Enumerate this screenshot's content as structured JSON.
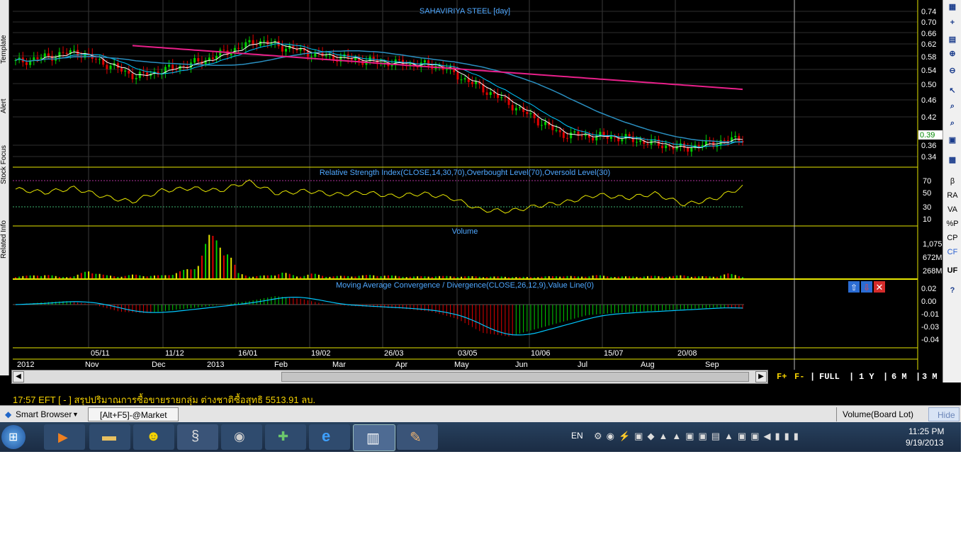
{
  "chart_title": "SAHAVIRIYA STEEL [day]",
  "price_last_label": "0.39",
  "price_ticks": [
    "0.74",
    "0.70",
    "0.66",
    "0.62",
    "0.58",
    "0.54",
    "0.50",
    "0.46",
    "0.42",
    "0.36",
    "0.34"
  ],
  "rsi_title": "Relative Strength Index(CLOSE,14,30,70),Overbought Level(70),Oversold Level(30)",
  "rsi_ticks": [
    "70",
    "50",
    "30",
    "10"
  ],
  "volume_title": "Volume",
  "volume_ticks": [
    "1,075",
    "672M",
    "268M"
  ],
  "macd_title": "Moving Average Convergence / Divergence(CLOSE,26,12,9),Value Line(0)",
  "macd_ticks": [
    "0.02",
    "0.00",
    "-0.01",
    "-0.03",
    "-0.04"
  ],
  "date_ticks": [
    "05/11",
    "11/12",
    "16/01",
    "19/02",
    "26/03",
    "03/05",
    "10/06",
    "15/07",
    "20/08"
  ],
  "month_ticks": [
    "2012",
    "Nov",
    "Dec",
    "2013",
    "Feb",
    "Mar",
    "Apr",
    "May",
    "Jun",
    "Jul",
    "Aug",
    "Sep"
  ],
  "left_tabs": [
    "Template",
    "Alert",
    "Stock Focus",
    "Related Info"
  ],
  "right_toolbar": [
    "β",
    "RA",
    "VA",
    "%P",
    "CP",
    "CF",
    "UF"
  ],
  "range_buttons": {
    "fplus": "F+",
    "fminus": "F-",
    "full": "FULL",
    "y1": "1 Y",
    "m6": "6 M",
    "m3": "3 M"
  },
  "ticker_text": "17:57  EFT  [ - ]  สรุปปริมาณการซื้อขายรายกลุ่ม ต่างชาติซื้อสุทธิ 5513.91 ลบ.",
  "tabs": {
    "smart_browser": "Smart Browser",
    "market": "[Alt+F5]-@Market",
    "volume_board": "Volume(Board Lot)",
    "hide": "Hide"
  },
  "tray": {
    "lang": "EN",
    "time": "11:25 PM",
    "date": "9/19/2013"
  },
  "colors": {
    "candle_up": "#00d000",
    "candle_down": "#e00000",
    "ma_short": "#ffffff",
    "ma_mid": "#00c8ff",
    "ma_long": "#e8208a",
    "rsi": "#e6e600",
    "macd_line": "#00c8ff",
    "panel_border": "#e6e600"
  },
  "chart_data": [
    {
      "type": "line",
      "title": "SAHAVIRIYA STEEL [day]",
      "ylim": [
        0.32,
        0.75
      ],
      "x": [
        "Oct 2012",
        "Nov 2012",
        "Dec 2012",
        "Jan 2013",
        "Feb 2013",
        "Mar 2013",
        "Apr 2013",
        "May 2013",
        "Jun 2013",
        "Jul 2013",
        "Aug 2013",
        "Sep 2013"
      ],
      "series": [
        {
          "values": [
            0.6,
            0.63,
            0.56,
            0.6,
            0.66,
            0.62,
            0.6,
            0.59,
            0.5,
            0.4,
            0.39,
            0.36,
            0.39
          ]
        }
      ]
    },
    {
      "type": "line",
      "title": "Relative Strength Index(CLOSE,14,30,70),Overbought Level(70),Oversold Level(30)",
      "ylim": [
        0,
        80
      ],
      "series": [
        {
          "values": [
            58,
            52,
            60,
            45,
            35,
            55,
            60,
            55,
            72,
            50,
            55,
            48,
            52,
            45,
            50,
            42,
            20,
            18,
            28,
            35,
            48,
            42,
            50,
            30,
            40,
            62
          ]
        }
      ]
    },
    {
      "type": "bar",
      "title": "Volume",
      "ylim": [
        0,
        1300
      ],
      "values": [
        60,
        80,
        120,
        40,
        70,
        250,
        90,
        60,
        110,
        80,
        90,
        200,
        300,
        1200,
        1150,
        150,
        60,
        90,
        180,
        60,
        140,
        60,
        70,
        80,
        100,
        90,
        60,
        55,
        70,
        65,
        60,
        60,
        50,
        55,
        40,
        45,
        60,
        80,
        50,
        100,
        60,
        55,
        60,
        70,
        60,
        90,
        60,
        55,
        140,
        60
      ]
    },
    {
      "type": "line",
      "title": "Moving Average Convergence / Divergence(CLOSE,26,12,9),Value Line(0)",
      "ylim": [
        -0.05,
        0.03
      ],
      "series": [
        {
          "values": [
            0.0,
            0.003,
            0.005,
            0.0,
            -0.01,
            -0.012,
            -0.008,
            -0.004,
            0.0,
            0.005,
            0.012,
            0.008,
            0.0,
            -0.002,
            -0.004,
            -0.006,
            -0.01,
            -0.02,
            -0.04,
            -0.045,
            -0.035,
            -0.025,
            -0.015,
            -0.012,
            -0.01,
            -0.008,
            -0.006,
            -0.004,
            -0.006
          ]
        }
      ]
    }
  ]
}
